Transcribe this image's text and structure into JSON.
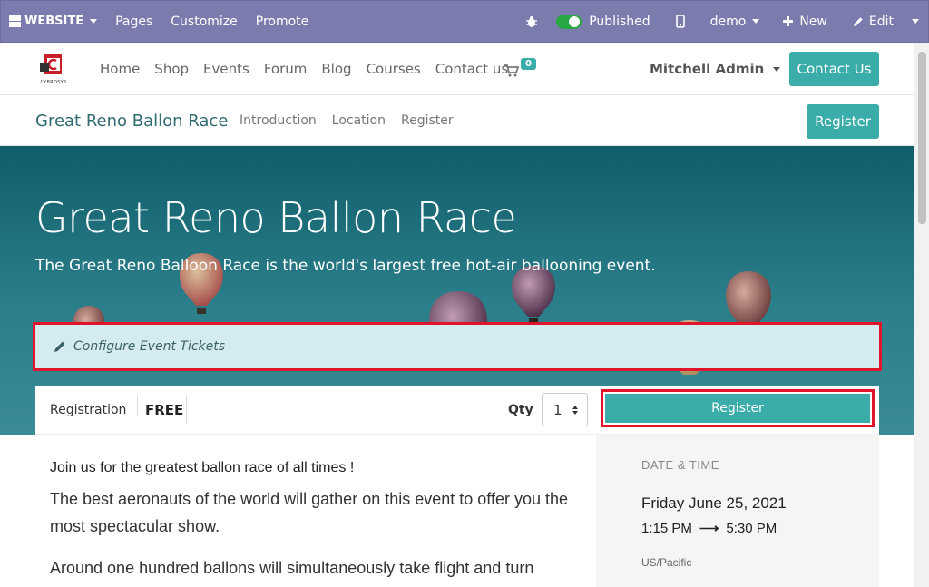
{
  "adminbar": {
    "website_label": "WEBSITE",
    "pages": "Pages",
    "customize": "Customize",
    "promote": "Promote",
    "published": "Published",
    "demo": "demo",
    "new": "New",
    "edit": "Edit"
  },
  "navbar": {
    "links": [
      "Home",
      "Shop",
      "Events",
      "Forum",
      "Blog",
      "Courses",
      "Contact us"
    ],
    "cart_count": "0",
    "user": "Mitchell Admin",
    "contact_button": "Contact Us",
    "logo_text": "CYBROSYS"
  },
  "subnav": {
    "title": "Great Reno Ballon Race",
    "links": [
      "Introduction",
      "Location",
      "Register"
    ],
    "register_button": "Register"
  },
  "hero": {
    "title": "Great Reno Ballon Race",
    "subtitle": "The Great Reno Balloon Race is the world's largest free hot-air ballooning event."
  },
  "tickets": {
    "configure_label": "Configure Event Tickets"
  },
  "registration": {
    "label": "Registration",
    "price": "FREE",
    "qty_label": "Qty",
    "qty_value": "1",
    "register_button": "Register"
  },
  "content": {
    "lead": "Join us for the greatest ballon race of all times !",
    "p1": "The best aeronauts of the world will gather on this event to offer you the most spectacular show.",
    "p2": "Around one hundred ballons will simultaneously take flight and turn"
  },
  "datetime": {
    "label": "DATE & TIME",
    "date": "Friday June 25, 2021",
    "start": "1:15 PM",
    "end": "5:30 PM",
    "timezone": "US/Pacific"
  },
  "colors": {
    "adminbar": "#7c7bad",
    "teal": "#3aadaa",
    "highlight": "#e0152c"
  }
}
